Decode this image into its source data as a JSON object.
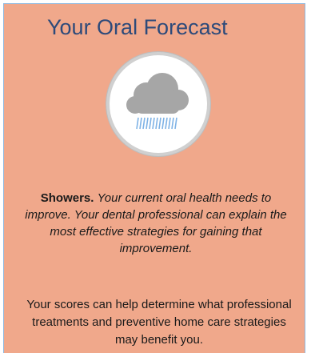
{
  "card": {
    "title": "Your Oral Forecast",
    "icon": "rain-cloud-icon",
    "forecast_label": "Showers.",
    "forecast_description": "Your current oral health needs to improve. Your dental professional can explain the most effective strategies for gaining that improvement.",
    "scores_text": "Your scores can help determine what professional treatments and preventive home care strategies may benefit you."
  },
  "colors": {
    "background": "#f0a88b",
    "title": "#2d4a7a",
    "cloud": "#a6a6a6",
    "rain": "#7fb3e6"
  }
}
